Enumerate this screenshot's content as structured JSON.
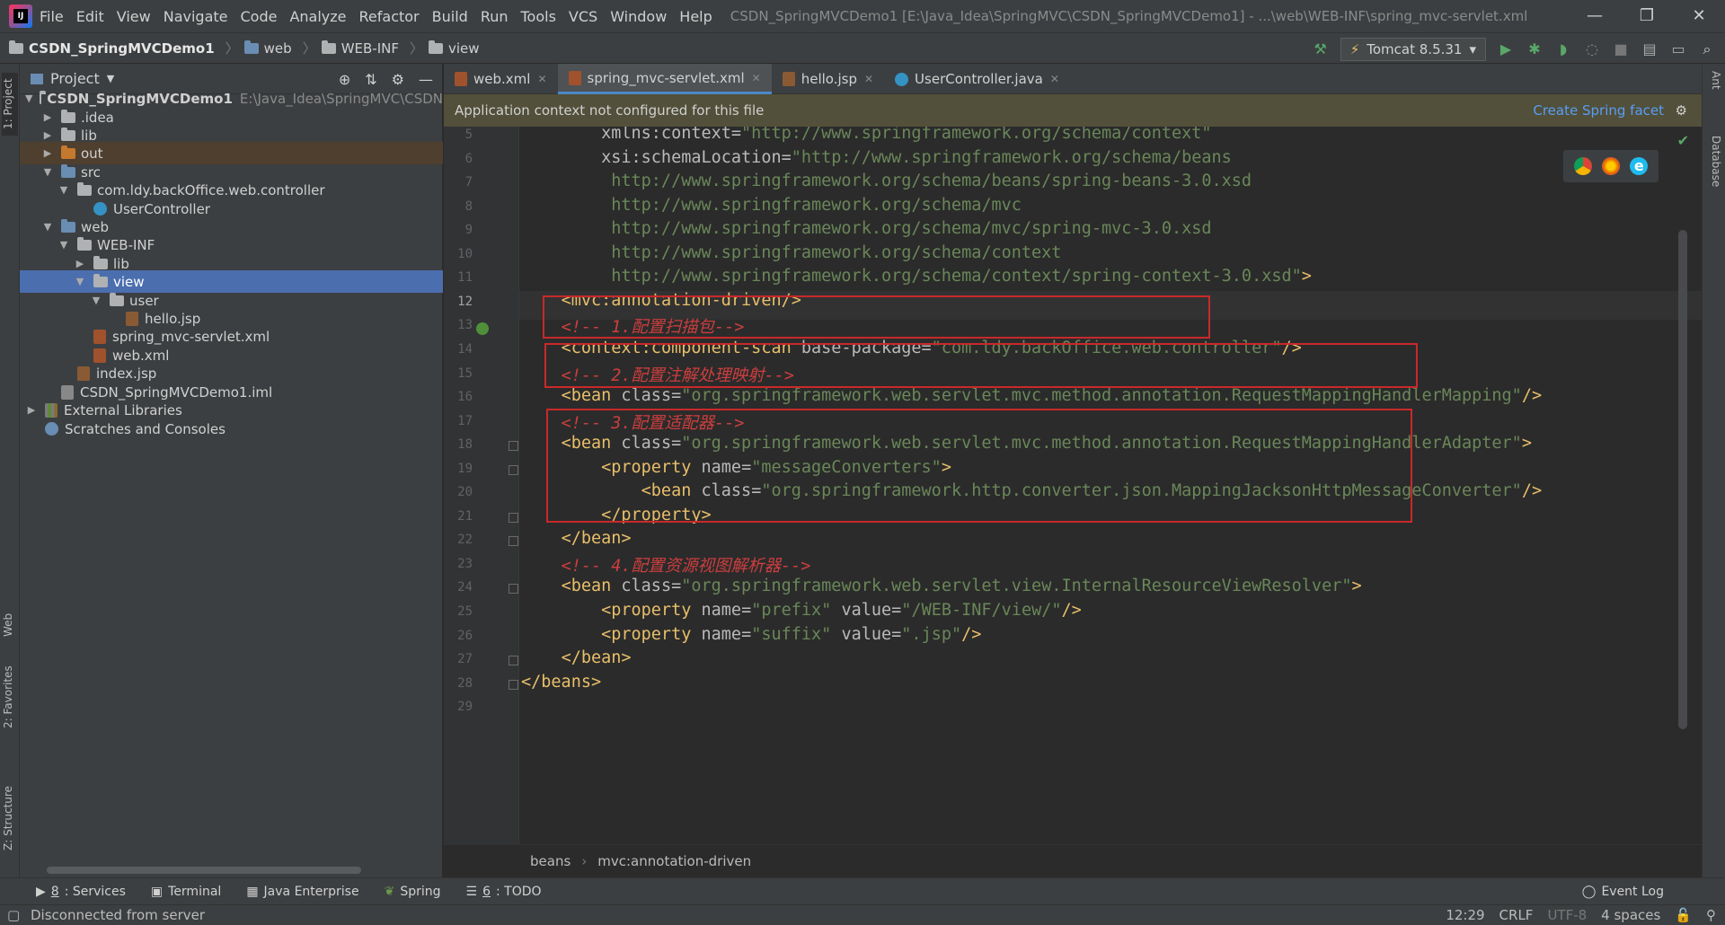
{
  "menu": [
    "File",
    "Edit",
    "View",
    "Navigate",
    "Code",
    "Analyze",
    "Refactor",
    "Build",
    "Run",
    "Tools",
    "VCS",
    "Window",
    "Help"
  ],
  "window_title": "CSDN_SpringMVCDemo1 [E:\\Java_Idea\\SpringMVC\\CSDN_SpringMVCDemo1] - ...\\web\\WEB-INF\\spring_mvc-servlet.xml",
  "window_controls": [
    "—",
    "❐",
    "✕"
  ],
  "breadcrumb": [
    "CSDN_SpringMVCDemo1",
    "web",
    "WEB-INF",
    "view"
  ],
  "run_config": "Tomcat 8.5.31",
  "project_panel": {
    "title": "Project"
  },
  "tree": [
    {
      "label": "CSDN_SpringMVCDemo1",
      "extra": "E:\\Java_Idea\\SpringMVC\\CSDN",
      "arrow": "▼",
      "icon": "folder"
    },
    {
      "label": ".idea",
      "arrow": "▶",
      "icon": "folder"
    },
    {
      "label": "lib",
      "arrow": "▶",
      "icon": "folder"
    },
    {
      "label": "out",
      "arrow": "▶",
      "icon": "folder-orange"
    },
    {
      "label": "src",
      "arrow": "▼",
      "icon": "folder-blue"
    },
    {
      "label": "com.ldy.backOffice.web.controller",
      "arrow": "▼",
      "icon": "package"
    },
    {
      "label": "UserController",
      "arrow": "",
      "icon": "class"
    },
    {
      "label": "web",
      "arrow": "▼",
      "icon": "folder-blue"
    },
    {
      "label": "WEB-INF",
      "arrow": "▼",
      "icon": "folder"
    },
    {
      "label": "lib",
      "arrow": "▶",
      "icon": "folder"
    },
    {
      "label": "view",
      "arrow": "▼",
      "icon": "folder"
    },
    {
      "label": "user",
      "arrow": "▼",
      "icon": "folder"
    },
    {
      "label": "hello.jsp",
      "arrow": "",
      "icon": "jsp"
    },
    {
      "label": "spring_mvc-servlet.xml",
      "arrow": "",
      "icon": "xml"
    },
    {
      "label": "web.xml",
      "arrow": "",
      "icon": "xml"
    },
    {
      "label": "index.jsp",
      "arrow": "",
      "icon": "jsp"
    },
    {
      "label": "CSDN_SpringMVCDemo1.iml",
      "arrow": "",
      "icon": "iml"
    },
    {
      "label": "External Libraries",
      "arrow": "▶",
      "icon": "libs"
    },
    {
      "label": "Scratches and Consoles",
      "arrow": "",
      "icon": "scratch"
    }
  ],
  "tabs": [
    {
      "label": "web.xml",
      "close": "✕"
    },
    {
      "label": "spring_mvc-servlet.xml",
      "close": "✕"
    },
    {
      "label": "hello.jsp",
      "close": "✕"
    },
    {
      "label": "UserController.java",
      "close": "✕"
    }
  ],
  "banner": {
    "message": "Application context not configured for this file",
    "action": "Create Spring facet"
  },
  "code_lines": [
    {
      "n": "5",
      "html": "        <span class='attr'>xmlns:context</span>=<span class='str'>\"http://www.springframework.org/schema/context\"</span>"
    },
    {
      "n": "6",
      "html": "        <span class='attr'>xsi:schemaLocation</span>=<span class='str'>\"http://www.springframework.org/schema/beans</span>"
    },
    {
      "n": "7",
      "html": "<span class='str'>         http://www.springframework.org/schema/beans/spring-beans-3.0.xsd</span>"
    },
    {
      "n": "8",
      "html": "<span class='str'>         http://www.springframework.org/schema/mvc</span>"
    },
    {
      "n": "9",
      "html": "<span class='str'>         http://www.springframework.org/schema/mvc/spring-mvc-3.0.xsd</span>"
    },
    {
      "n": "10",
      "html": "<span class='str'>         http://www.springframework.org/schema/context</span>"
    },
    {
      "n": "11",
      "html": "<span class='str'>         http://www.springframework.org/schema/context/spring-context-3.0.xsd\"</span><span class='tag'>&gt;</span>"
    },
    {
      "n": "12",
      "html": "    <span class='tag'>&lt;mvc:annotation-driven/&gt;</span>"
    },
    {
      "n": "13",
      "html": "    <span class='cmt'>&lt;!-- 1.配置扫描包--&gt;</span>"
    },
    {
      "n": "14",
      "html": "    <span class='tag'>&lt;context:component-scan </span><span class='attr'>base-package</span>=<span class='str'>\"com.ldy.backOffice.web.controller\"</span><span class='tag'>/&gt;</span>"
    },
    {
      "n": "15",
      "html": "    <span class='cmt'>&lt;!-- 2.配置注解处理映射--&gt;</span>"
    },
    {
      "n": "16",
      "html": "    <span class='tag'>&lt;bean </span><span class='attr'>class</span>=<span class='str'>\"org.springframework.web.servlet.mvc.method.annotation.RequestMappingHandlerMapping\"</span><span class='tag'>/&gt;</span>"
    },
    {
      "n": "17",
      "html": "    <span class='cmt'>&lt;!-- 3.配置适配器--&gt;</span>"
    },
    {
      "n": "18",
      "html": "    <span class='tag'>&lt;bean </span><span class='attr'>class</span>=<span class='str'>\"org.springframework.web.servlet.mvc.method.annotation.RequestMappingHandlerAdapter\"</span><span class='tag'>&gt;</span>"
    },
    {
      "n": "19",
      "html": "        <span class='tag'>&lt;property </span><span class='attr'>name</span>=<span class='str'>\"messageConverters\"</span><span class='tag'>&gt;</span>"
    },
    {
      "n": "20",
      "html": "            <span class='tag'>&lt;bean </span><span class='attr'>class</span>=<span class='str'>\"org.springframework.http.converter.json.MappingJacksonHttpMessageConverter\"</span><span class='tag'>/&gt;</span>"
    },
    {
      "n": "21",
      "html": "        <span class='tag'>&lt;/property&gt;</span>"
    },
    {
      "n": "22",
      "html": "    <span class='tag'>&lt;/bean&gt;</span>"
    },
    {
      "n": "23",
      "html": "    <span class='cmt'>&lt;!-- 4.配置资源视图解析器--&gt;</span>"
    },
    {
      "n": "24",
      "html": "    <span class='tag'>&lt;bean </span><span class='attr'>class</span>=<span class='str'>\"org.springframework.web.servlet.view.InternalResourceViewResolver\"</span><span class='tag'>&gt;</span>"
    },
    {
      "n": "25",
      "html": "        <span class='tag'>&lt;property </span><span class='attr'>name</span>=<span class='str'>\"prefix\"</span> <span class='attr'>value</span>=<span class='str'>\"/WEB-INF/view/\"</span><span class='tag'>/&gt;</span>"
    },
    {
      "n": "26",
      "html": "        <span class='tag'>&lt;property </span><span class='attr'>name</span>=<span class='str'>\"suffix\"</span> <span class='attr'>value</span>=<span class='str'>\".jsp\"</span><span class='tag'>/&gt;</span>"
    },
    {
      "n": "27",
      "html": "    <span class='tag'>&lt;/bean&gt;</span>"
    },
    {
      "n": "28",
      "html": "<span class='tag'>&lt;/beans&gt;</span>"
    },
    {
      "n": "29",
      "html": ""
    }
  ],
  "current_line": "12",
  "editor_breadcrumb": [
    "beans",
    "mvc:annotation-driven"
  ],
  "left_stripe": [
    "1: Project",
    "Web",
    "2: Favorites",
    "Z: Structure"
  ],
  "right_stripe": [
    "Ant",
    "Database"
  ],
  "bottom_tools": [
    {
      "key": "8",
      "label": ": Services"
    },
    {
      "key": "",
      "label": "Terminal"
    },
    {
      "key": "",
      "label": "Java Enterprise"
    },
    {
      "key": "",
      "label": "Spring"
    },
    {
      "key": "6",
      "label": ": TODO"
    }
  ],
  "event_log": "Event Log",
  "status": {
    "message": "Disconnected from server",
    "position": "12:29",
    "line_sep": "CRLF",
    "encoding": "UTF-8",
    "indent": "4 spaces"
  },
  "colors": {
    "tag": "#e8bf6a",
    "string": "#6a8759",
    "comment": "#cc3e3e",
    "highlight_box": "#c9292a",
    "selection": "#4b6eaf"
  }
}
